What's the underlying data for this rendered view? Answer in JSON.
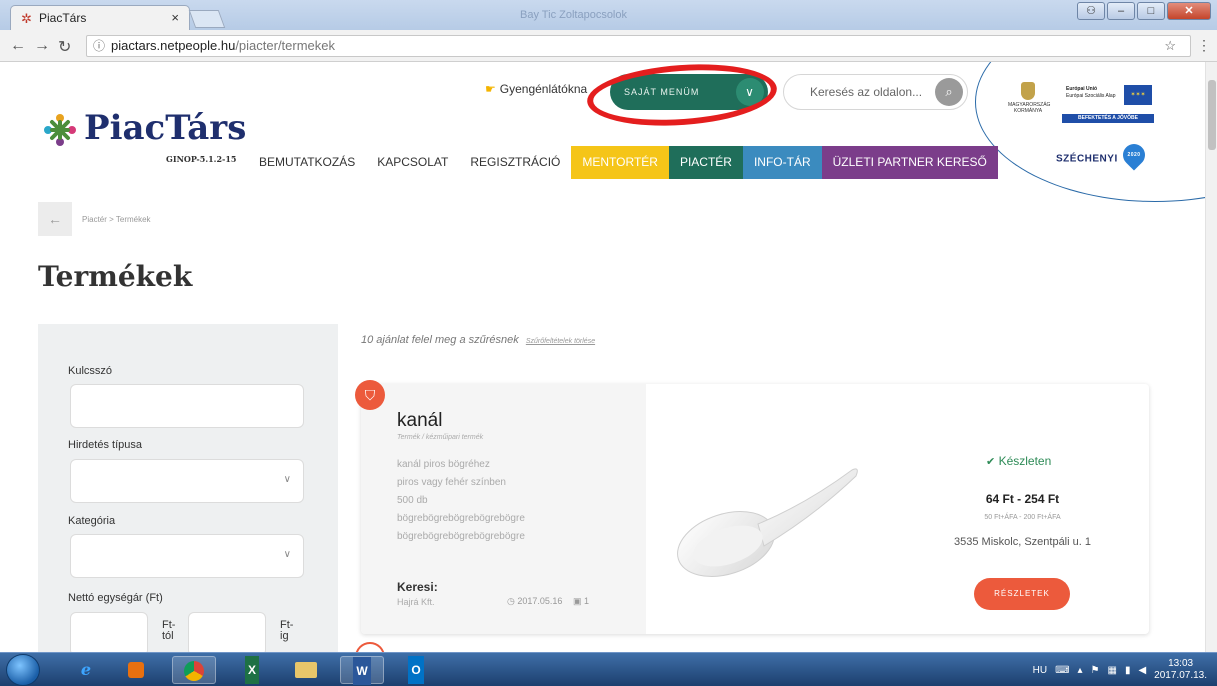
{
  "browser": {
    "tab_title": "PiacTárs",
    "tab_close": "×",
    "window_title": "Bay Tic Zoltapocsolok",
    "url_domain": "piactars.netpeople.hu",
    "url_path": "/piacter/termekek"
  },
  "header": {
    "logo_name": "PiacTárs",
    "logo_sub": "GINOP-5.1.2-15",
    "accessibility_label": "Gyengénlátókna",
    "my_menu_label": "SAJÁT MENÜM",
    "search_placeholder": "Keresés az oldalon...",
    "gov_label": "MAGYARORSZÁG KORMÁNYA",
    "eu_title": "Európai Unió",
    "eu_subtitle": "Európai Szociális Alap",
    "eu_band": "BEFEKTETÉS A JÖVŐBE",
    "szechenyi": "SZÉCHENYI",
    "szechenyi_year": "2020"
  },
  "nav": {
    "items": [
      {
        "label": "BEMUTATKOZÁS"
      },
      {
        "label": "KAPCSOLAT"
      },
      {
        "label": "REGISZTRÁCIÓ"
      },
      {
        "label": "MENTORTÉR"
      },
      {
        "label": "PIACTÉR"
      },
      {
        "label": "INFO-TÁR"
      },
      {
        "label": "ÜZLETI PARTNER KERESŐ"
      }
    ]
  },
  "breadcrumb": "Piactér > Termékek",
  "page_title": "Termékek",
  "filters": {
    "keyword_label": "Kulcsszó",
    "type_label": "Hirdetés típusa",
    "category_label": "Kategória",
    "price_label": "Nettó egységár (Ft)",
    "from_unit": "Ft-\ntól",
    "to_unit": "Ft-\nig"
  },
  "results": {
    "summary": "10 ajánlat felel meg a szűrésnek",
    "clear_link": "Szűrőfeltételek törlése"
  },
  "product": {
    "title": "kanál",
    "category": "Termék / kézműipari termék",
    "description": "kanál piros bögréhez\npiros vagy fehér színben\n500 db\nbögrebögrebögrebögrebögre\nbögrebögrebögrebögrebögre",
    "keresi_label": "Keresi:",
    "seller": "Hajrá Kft.",
    "date": "2017.05.16",
    "image_count": "1",
    "stock": "Készleten",
    "price": "64 Ft - 254 Ft",
    "price_vat": "50 Ft+ÁFA - 200 Ft+ÁFA",
    "address": "3535 Miskolc, Szentpáli u. 1",
    "details_button": "RÉSZLETEK"
  },
  "taskbar": {
    "lang": "HU",
    "time": "13:03",
    "date": "2017.07.13."
  },
  "colors": {
    "brand_navy": "#1f2f6e",
    "piacter_green": "#1f6e5a",
    "mentor_yellow": "#f5c518",
    "info_blue": "#3b8bbf",
    "partner_purple": "#7b3d8a",
    "accent_orange": "#ec5a3c",
    "annotation_red": "#e41e1e"
  }
}
